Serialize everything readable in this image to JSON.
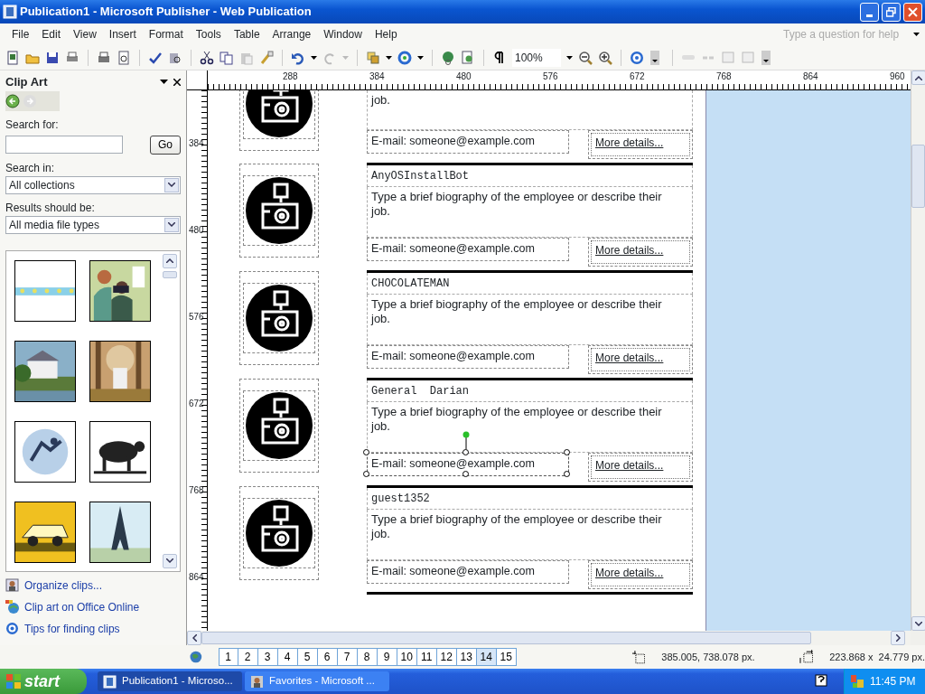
{
  "window": {
    "title": "Publication1 - Microsoft Publisher - Web Publication"
  },
  "menu": [
    "File",
    "Edit",
    "View",
    "Insert",
    "Format",
    "Tools",
    "Table",
    "Arrange",
    "Window",
    "Help"
  ],
  "help_box": {
    "placeholder": "Type a question for help"
  },
  "toolbar": {
    "zoom": "100%"
  },
  "task_pane": {
    "title": "Clip Art",
    "search_label": "Search for:",
    "go_button": "Go",
    "search_in_label": "Search in:",
    "search_in": "All collections",
    "results_label": "Results should be:",
    "results": "All media file types",
    "links": [
      "Organize clips...",
      "Clip art on Office Online",
      "Tips for finding clips"
    ]
  },
  "rulers": {
    "horizontal": [
      "288",
      "384",
      "480",
      "576",
      "672",
      "768",
      "864",
      "960"
    ],
    "vertical": [
      "384",
      "480",
      "576",
      "672",
      "768",
      "864"
    ]
  },
  "entries": [
    {
      "bio": "job.",
      "email": "E-mail: someone@example.com",
      "more": "More details...",
      "selected": false
    },
    {
      "name": "AnyOSInstallBot",
      "bio": "Type a brief biography of the employee or describe their job.",
      "email": "E-mail: someone@example.com",
      "more": "More details...",
      "selected": false
    },
    {
      "name": "CHOCOLATEMAN",
      "bio": "Type a brief biography of the employee or describe their job.",
      "email": "E-mail: someone@example.com",
      "more": "More details...",
      "selected": false
    },
    {
      "name": "General  Darian",
      "bio": "Type a brief biography of the employee or describe their job.",
      "email": "E-mail: someone@example.com",
      "more": "More details...",
      "selected": true
    },
    {
      "name": "guest1352",
      "bio": "Type a brief biography of the employee or describe their job.",
      "email": "E-mail: someone@example.com",
      "more": "More details...",
      "selected": false
    }
  ],
  "status": {
    "pages": [
      {
        "label": "1",
        "selected": false
      },
      {
        "label": "2",
        "selected": false
      },
      {
        "label": "3",
        "selected": false
      },
      {
        "label": "4",
        "selected": false
      },
      {
        "label": "5",
        "selected": false
      },
      {
        "label": "6",
        "selected": false
      },
      {
        "label": "7",
        "selected": false
      },
      {
        "label": "8",
        "selected": false
      },
      {
        "label": "9",
        "selected": false
      },
      {
        "label": "10",
        "selected": false
      },
      {
        "label": "11",
        "selected": false
      },
      {
        "label": "12",
        "selected": false
      },
      {
        "label": "13",
        "selected": false
      },
      {
        "label": "14",
        "selected": true
      },
      {
        "label": "15",
        "selected": false
      }
    ],
    "position": "385.005, 738.078 px.",
    "size": "223.868 x  24.779 px."
  },
  "taskbar": {
    "start": "start",
    "tasks": [
      {
        "label": "Publication1 - Microso...",
        "selected": true
      },
      {
        "label": "Favorites - Microsoft ...",
        "selected": false
      }
    ],
    "clock": "11:45 PM"
  }
}
